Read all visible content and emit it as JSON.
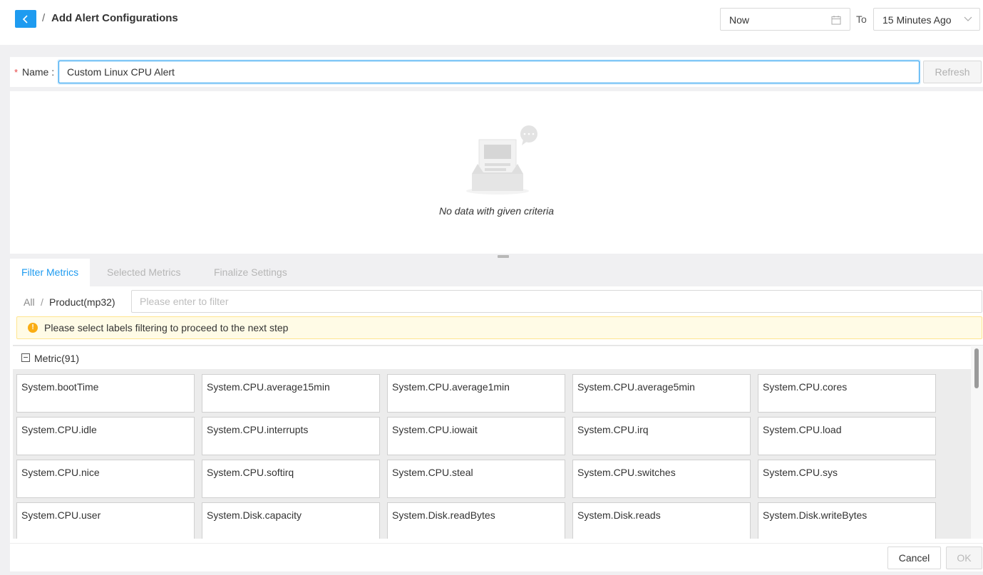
{
  "header": {
    "separator": "/",
    "title": "Add Alert Configurations",
    "time_start": "Now",
    "to_label": "To",
    "time_range": "15 Minutes Ago"
  },
  "form": {
    "required_mark": "*",
    "name_label": "Name",
    "name_value": "Custom Linux CPU Alert",
    "refresh_label": "Refresh"
  },
  "preview": {
    "empty_text": "No data with given criteria"
  },
  "tabs": [
    {
      "label": "Filter Metrics",
      "active": true
    },
    {
      "label": "Selected Metrics",
      "active": false
    },
    {
      "label": "Finalize Settings",
      "active": false
    }
  ],
  "filter": {
    "breadcrumb_all": "All",
    "breadcrumb_sep": "/",
    "breadcrumb_product": "Product(mp32)",
    "placeholder": "Please enter to filter",
    "warning": "Please select labels filtering to proceed to the next step"
  },
  "metrics": {
    "title": "Metric(91)",
    "items": [
      "System.bootTime",
      "System.CPU.average15min",
      "System.CPU.average1min",
      "System.CPU.average5min",
      "System.CPU.cores",
      "System.CPU.idle",
      "System.CPU.interrupts",
      "System.CPU.iowait",
      "System.CPU.irq",
      "System.CPU.load",
      "System.CPU.nice",
      "System.CPU.softirq",
      "System.CPU.steal",
      "System.CPU.switches",
      "System.CPU.sys",
      "System.CPU.user",
      "System.Disk.capacity",
      "System.Disk.readBytes",
      "System.Disk.reads",
      "System.Disk.writeBytes"
    ]
  },
  "footer": {
    "cancel_label": "Cancel",
    "ok_label": "OK"
  },
  "colors": {
    "accent": "#1e9bf0",
    "warning_bg": "#fffbe6",
    "warning_icon": "#faad14"
  },
  "icons": {
    "back": "chevron-left-icon",
    "calendar": "calendar-icon",
    "dropdown": "chevron-down-icon",
    "empty": "empty-inbox-icon",
    "warning": "exclamation-circle-icon",
    "collapse": "minus-square-icon"
  }
}
